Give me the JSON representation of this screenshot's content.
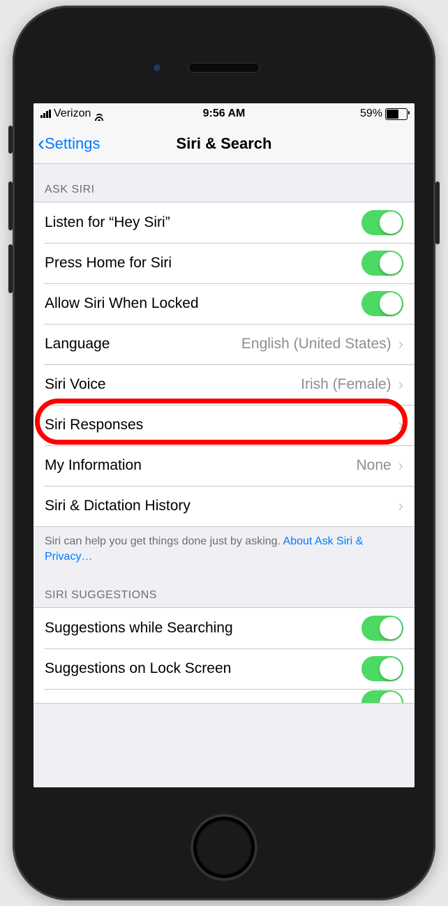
{
  "statusbar": {
    "carrier": "Verizon",
    "time": "9:56 AM",
    "battery_pct": "59%"
  },
  "navbar": {
    "back_label": "Settings",
    "title": "Siri & Search"
  },
  "section1": {
    "header": "ASK SIRI",
    "row0": {
      "label": "Listen for “Hey Siri”"
    },
    "row1": {
      "label": "Press Home for Siri"
    },
    "row2": {
      "label": "Allow Siri When Locked"
    },
    "row3": {
      "label": "Language",
      "detail": "English (United States)"
    },
    "row4": {
      "label": "Siri Voice",
      "detail": "Irish (Female)"
    },
    "row5": {
      "label": "Siri Responses"
    },
    "row6": {
      "label": "My Information",
      "detail": "None"
    },
    "row7": {
      "label": "Siri & Dictation History"
    },
    "footer_text": "Siri can help you get things done just by asking. ",
    "footer_link": "About Ask Siri & Privacy…"
  },
  "section2": {
    "header": "SIRI SUGGESTIONS",
    "row0": {
      "label": "Suggestions while Searching"
    },
    "row1": {
      "label": "Suggestions on Lock Screen"
    }
  }
}
